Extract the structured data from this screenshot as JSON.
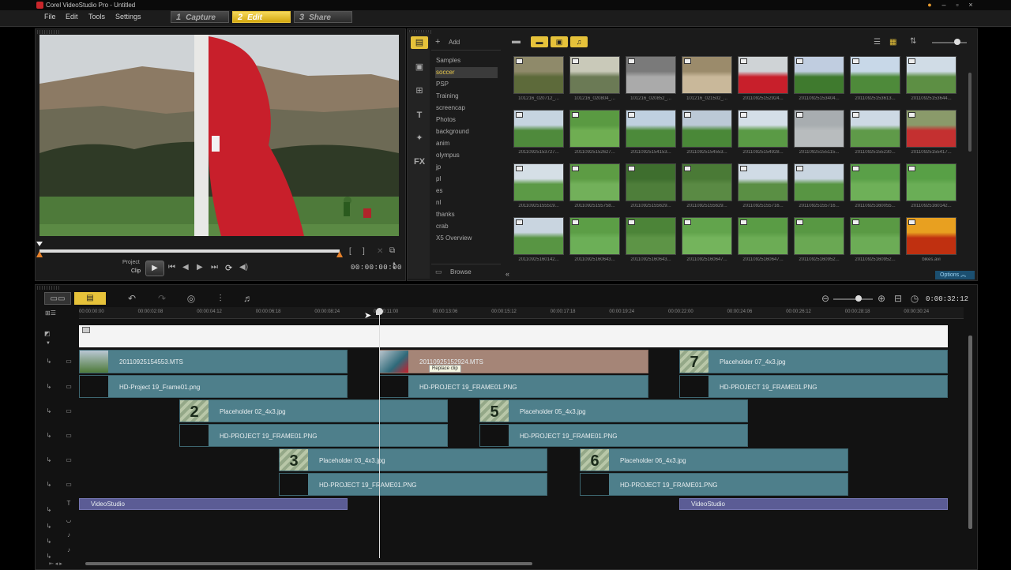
{
  "window": {
    "title": "Corel VideoStudio Pro - Untitled"
  },
  "menu": [
    "File",
    "Edit",
    "Tools",
    "Settings"
  ],
  "steps": [
    {
      "num": "1",
      "label": "Capture"
    },
    {
      "num": "2",
      "label": "Edit"
    },
    {
      "num": "3",
      "label": "Share"
    }
  ],
  "player": {
    "project": "Project",
    "clip": "Clip",
    "timecode": "00:00:00:00"
  },
  "library": {
    "add_label": "Add",
    "browse_label": "Browse",
    "options_label": "Options",
    "folders": [
      "Samples",
      "soccer",
      "PSP",
      "Training",
      "screencap",
      "Photos",
      "background",
      "anim",
      "olympus",
      "jp",
      "pl",
      "es",
      "nl",
      "thanks",
      "crab",
      "X5 Overview"
    ],
    "selected_folder": "soccer",
    "thumbs": [
      "101216_020712_...",
      "101216_020804_...",
      "101216_020852_...",
      "101216_021502_...",
      "20110925152924...",
      "20110925153404...",
      "20110925153613...",
      "20110925153644...",
      "20110925153727...",
      "20110925152627...",
      "20110925154153...",
      "20110925154553...",
      "20110925154928...",
      "20110925155115...",
      "20110925155230...",
      "20110925155417...",
      "20110925155519...",
      "20110925155758...",
      "20110925155629...",
      "20110925155629...",
      "20110925155716...",
      "20110925155716...",
      "20110925160055...",
      "20110925160142...",
      "20110925160142...",
      "20110925160643...",
      "20110925160643...",
      "20110925160647...",
      "20110925160647...",
      "20110925160952...",
      "20110925160952...",
      "bikes.avi"
    ]
  },
  "timeline": {
    "duration": "0:00:32:12",
    "ruler": [
      "00:00:00:00",
      "00:00:02:08",
      "00:00:04:12",
      "00:00:06:18",
      "00:00:08:24",
      "00:00:11:00",
      "00:00:13:06",
      "00:00:15:12",
      "00:00:17:18",
      "00:00:19:24",
      "00:00:22:00",
      "00:00:24:06",
      "00:00:26:12",
      "00:00:28:18",
      "00:00:30:24"
    ],
    "tooltip": "Replace clip",
    "clips": {
      "v1a": "20110925154553.MTS",
      "v1b": "20110925152924.MTS",
      "v1c": "Placeholder 07_4x3.jpg",
      "m1a": "HD-Project 19_Frame01.png",
      "m1b": "HD-PROJECT 19_FRAME01.PNG",
      "m1c": "HD-PROJECT 19_FRAME01.PNG",
      "v2a": "Placeholder 02_4x3.jpg",
      "v2b": "Placeholder 05_4x3.jpg",
      "m2a": "HD-PROJECT 19_FRAME01.PNG",
      "m2b": "HD-PROJECT 19_FRAME01.PNG",
      "v3a": "Placeholder 03_4x3.jpg",
      "v3b": "Placeholder 06_4x3.jpg",
      "m3a": "HD-PROJECT 19_FRAME01.PNG",
      "m3b": "HD-PROJECT 19_FRAME01.PNG",
      "t1": "VideoStudio",
      "t2": "VideoStudio",
      "n2": "2",
      "n3": "3",
      "n5": "5",
      "n6": "6",
      "n7": "7"
    }
  }
}
